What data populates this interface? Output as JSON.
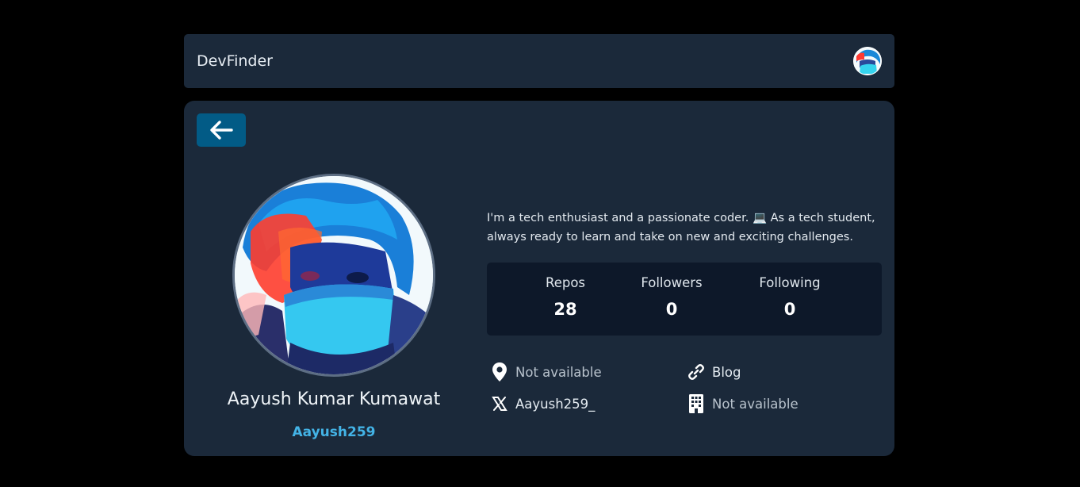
{
  "navbar": {
    "brand": "DevFinder",
    "avatar_icon": "user-avatar"
  },
  "profile": {
    "name": "Aayush Kumar Kumawat",
    "username": "Aayush259",
    "bio": "I'm a tech enthusiast and a passionate coder. 💻 As a tech student, always ready to learn and take on new and exciting challenges."
  },
  "stats": [
    {
      "label": "Repos",
      "value": "28"
    },
    {
      "label": "Followers",
      "value": "0"
    },
    {
      "label": "Following",
      "value": "0"
    }
  ],
  "info": {
    "location": {
      "icon": "location-pin-icon",
      "text": "Not available"
    },
    "blog": {
      "icon": "link-icon",
      "text": "Blog"
    },
    "twitter": {
      "icon": "x-logo-icon",
      "text": "Aayush259_"
    },
    "company": {
      "icon": "building-icon",
      "text": "Not available"
    }
  },
  "colors": {
    "background": "#000000",
    "card": "#1b293a",
    "stats_panel": "#0d1829",
    "accent_button": "#025b86",
    "username": "#43b3e6"
  }
}
